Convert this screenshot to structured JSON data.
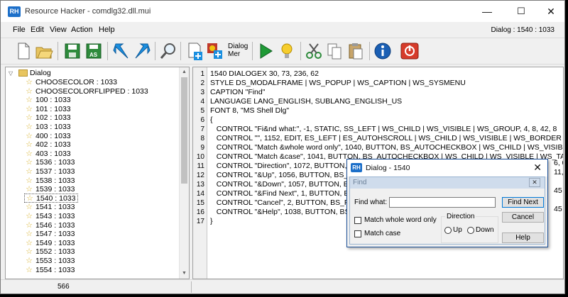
{
  "window": {
    "app_icon": "RH",
    "title": "Resource Hacker - comdlg32.dll.mui",
    "minimize": "—",
    "maximize": "☐",
    "close": "✕"
  },
  "menubar": {
    "items": [
      "File",
      "Edit",
      "View",
      "Action",
      "Help"
    ],
    "dialog_info": "Dialog : 1540 : 1033"
  },
  "toolbar": {
    "buttons": [
      {
        "icon": "new-file-icon"
      },
      {
        "icon": "open-folder-icon"
      },
      {
        "icon": "save-icon"
      },
      {
        "icon": "save-as-icon",
        "text": "AS"
      },
      {
        "icon": "back-arrow-icon"
      },
      {
        "icon": "forward-arrow-icon"
      },
      {
        "icon": "search-icon"
      },
      {
        "icon": "add-resource-icon"
      },
      {
        "icon": "dialog-merger-icon",
        "text": "Dialog Mer"
      },
      {
        "icon": "compile-run-icon"
      },
      {
        "icon": "lightbulb-icon"
      },
      {
        "icon": "cut-icon"
      },
      {
        "icon": "copy-icon"
      },
      {
        "icon": "paste-icon"
      },
      {
        "icon": "info-icon"
      },
      {
        "icon": "exit-icon"
      }
    ]
  },
  "tree": {
    "root": "Dialog",
    "items": [
      "CHOOSECOLOR : 1033",
      "CHOOSECOLORFLIPPED : 1033",
      "100 : 1033",
      "101 : 1033",
      "102 : 1033",
      "103 : 1033",
      "400 : 1033",
      "402 : 1033",
      "403 : 1033",
      "1536 : 1033",
      "1537 : 1033",
      "1538 : 1033",
      "1539 : 1033",
      "1540 : 1033",
      "1541 : 1033",
      "1543 : 1033",
      "1546 : 1033",
      "1547 : 1033",
      "1549 : 1033",
      "1552 : 1033",
      "1553 : 1033",
      "1554 : 1033"
    ],
    "selected": "1540 : 1033"
  },
  "editor": {
    "line_numbers": [
      "1",
      "2",
      "3",
      "4",
      "5",
      "6",
      "7",
      "8",
      "9",
      "10",
      "11",
      "12",
      "13",
      "14",
      "15",
      "16",
      "17"
    ],
    "lines": [
      "1540 DIALOGEX 30, 73, 236, 62",
      "STYLE DS_MODALFRAME | WS_POPUP | WS_CAPTION | WS_SYSMENU",
      "CAPTION \"Find\"",
      "LANGUAGE LANG_ENGLISH, SUBLANG_ENGLISH_US",
      "FONT 8, \"MS Shell Dlg\"",
      "{",
      "   CONTROL \"Fi&nd what:\", -1, STATIC, SS_LEFT | WS_CHILD | WS_VISIBLE | WS_GROUP, 4, 8, 42, 8",
      "   CONTROL \"\", 1152, EDIT, ES_LEFT | ES_AUTOHSCROLL | WS_CHILD | WS_VISIBLE | WS_BORDER | WS_",
      "   CONTROL \"Match &whole word only\", 1040, BUTTON, BS_AUTOCHECKBOX | WS_CHILD | WS_VISIBLE | W",
      "   CONTROL \"Match &case\", 1041, BUTTON, BS_AUTOCHECKBOX | WS_CHILD | WS_VISIBLE | WS_TABSTO",
      "   CONTROL \"Direction\", 1072, BUTTON, BS",
      "   CONTROL \"&Up\", 1056, BUTTON, BS_AU",
      "   CONTROL \"&Down\", 1057, BUTTON, BS_A",
      "   CONTROL \"&Find Next\", 1, BUTTON, BS_",
      "   CONTROL \"Cancel\", 2, BUTTON, BS_PUS",
      "   CONTROL \"&Help\", 1038, BUTTON, BS_P",
      "}"
    ],
    "right_fragments": [
      "6, 0",
      "11,",
      "45",
      "45"
    ]
  },
  "status": {
    "text": "566"
  },
  "preview": {
    "icon": "RH",
    "caption": "Dialog -  1540",
    "close": "✕",
    "find": {
      "title": "Find",
      "close": "✕",
      "find_what_label": "Find what:",
      "find_what_value": "",
      "find_next_label": "Find Next",
      "cancel_label": "Cancel",
      "help_label": "Help",
      "match_whole_label": "Match whole word only",
      "match_case_label": "Match case",
      "direction_label": "Direction",
      "up_label": "Up",
      "down_label": "Down"
    }
  }
}
